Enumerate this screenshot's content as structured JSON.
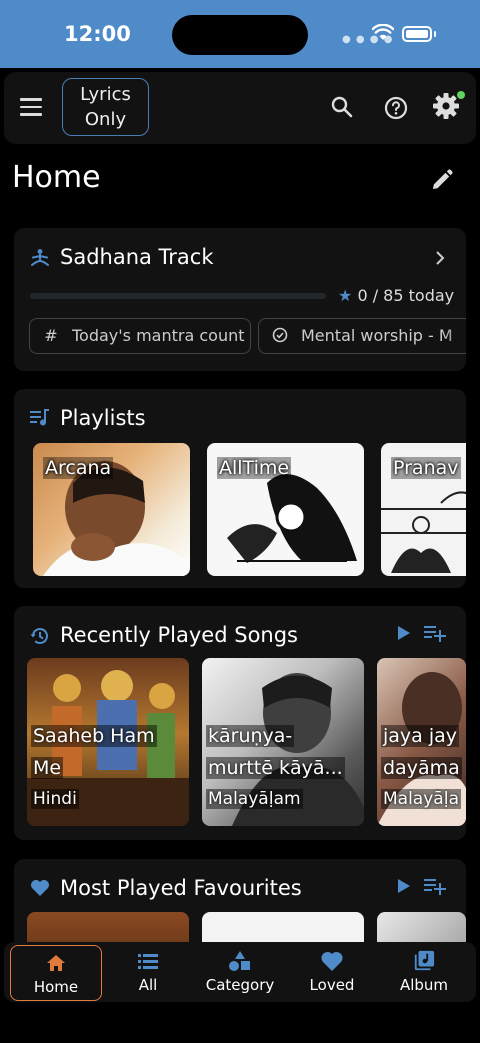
{
  "status": {
    "time": "12:00"
  },
  "topbar": {
    "lyrics_line1": "Lyrics",
    "lyrics_line2": "Only"
  },
  "page": {
    "title": "Home"
  },
  "sadhana": {
    "title": "Sadhana Track",
    "progress_text": "0 / 85 today",
    "progress_value": 0,
    "progress_max": 85,
    "chips": [
      "Today's mantra count",
      "Mental worship - M"
    ]
  },
  "playlists": {
    "title": "Playlists",
    "items": [
      "Arcana",
      "AllTime",
      "Pranav"
    ]
  },
  "recent": {
    "title": "Recently Played Songs",
    "songs": [
      {
        "name_line1": "Saaheb Ham",
        "name_line2": "Me",
        "language": "Hindi"
      },
      {
        "name_line1": "kāruṇya-",
        "name_line2": "murttē kāyā...",
        "language": "Malayāḷam"
      },
      {
        "name_line1": "jaya jay",
        "name_line2": "dayāma",
        "language": "Malayāḷa"
      }
    ]
  },
  "favourites": {
    "title": "Most Played Favourites"
  },
  "nav": [
    {
      "label": "Home",
      "icon": "home-icon"
    },
    {
      "label": "All",
      "icon": "list-icon"
    },
    {
      "label": "Category",
      "icon": "category-icon"
    },
    {
      "label": "Loved",
      "icon": "heart-icon"
    },
    {
      "label": "Album",
      "icon": "album-icon"
    }
  ],
  "colors": {
    "accent": "#4f8bc9",
    "active_nav": "#e07a3c",
    "card_bg": "#121212"
  }
}
